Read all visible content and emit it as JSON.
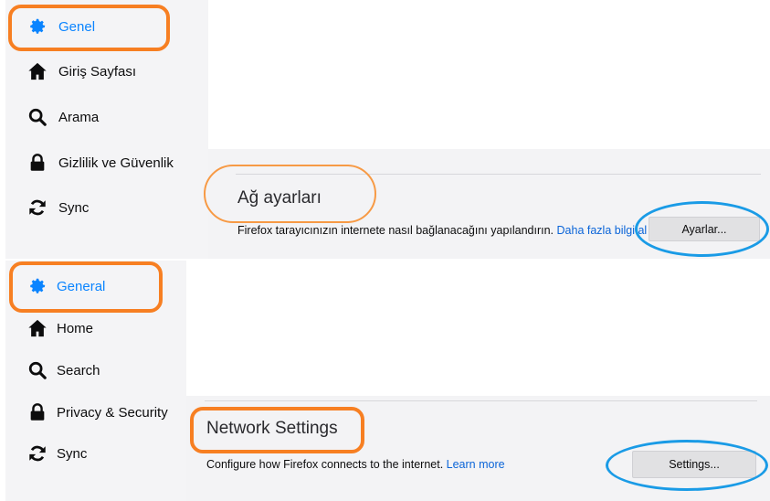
{
  "top": {
    "nav": [
      {
        "label": "Genel",
        "icon": "gear-icon",
        "selected": true
      },
      {
        "label": "Giriş Sayfası",
        "icon": "home-icon",
        "selected": false
      },
      {
        "label": "Arama",
        "icon": "search-icon",
        "selected": false
      },
      {
        "label": "Gizlilik ve Güvenlik",
        "icon": "lock-icon",
        "selected": false
      },
      {
        "label": "Sync",
        "icon": "sync-icon",
        "selected": false
      }
    ],
    "section_title": "Ağ ayarları",
    "description": "Firefox tarayıcınızın internete nasıl bağlanacağını yapılandırın.",
    "learn_more": "Daha fazla bilgi al",
    "button_label": "Ayarlar..."
  },
  "bottom": {
    "nav": [
      {
        "label": "General",
        "icon": "gear-icon",
        "selected": true
      },
      {
        "label": "Home",
        "icon": "home-icon",
        "selected": false
      },
      {
        "label": "Search",
        "icon": "search-icon",
        "selected": false
      },
      {
        "label": "Privacy & Security",
        "icon": "lock-icon",
        "selected": false
      },
      {
        "label": "Sync",
        "icon": "sync-icon",
        "selected": false
      }
    ],
    "section_title": "Network Settings",
    "description": "Configure how Firefox connects to the internet.",
    "learn_more": "Learn more",
    "button_label": "Settings..."
  },
  "colors": {
    "accent": "#0a84ff",
    "highlight_orange": "#f77f22",
    "highlight_blue": "#1a9be6"
  }
}
